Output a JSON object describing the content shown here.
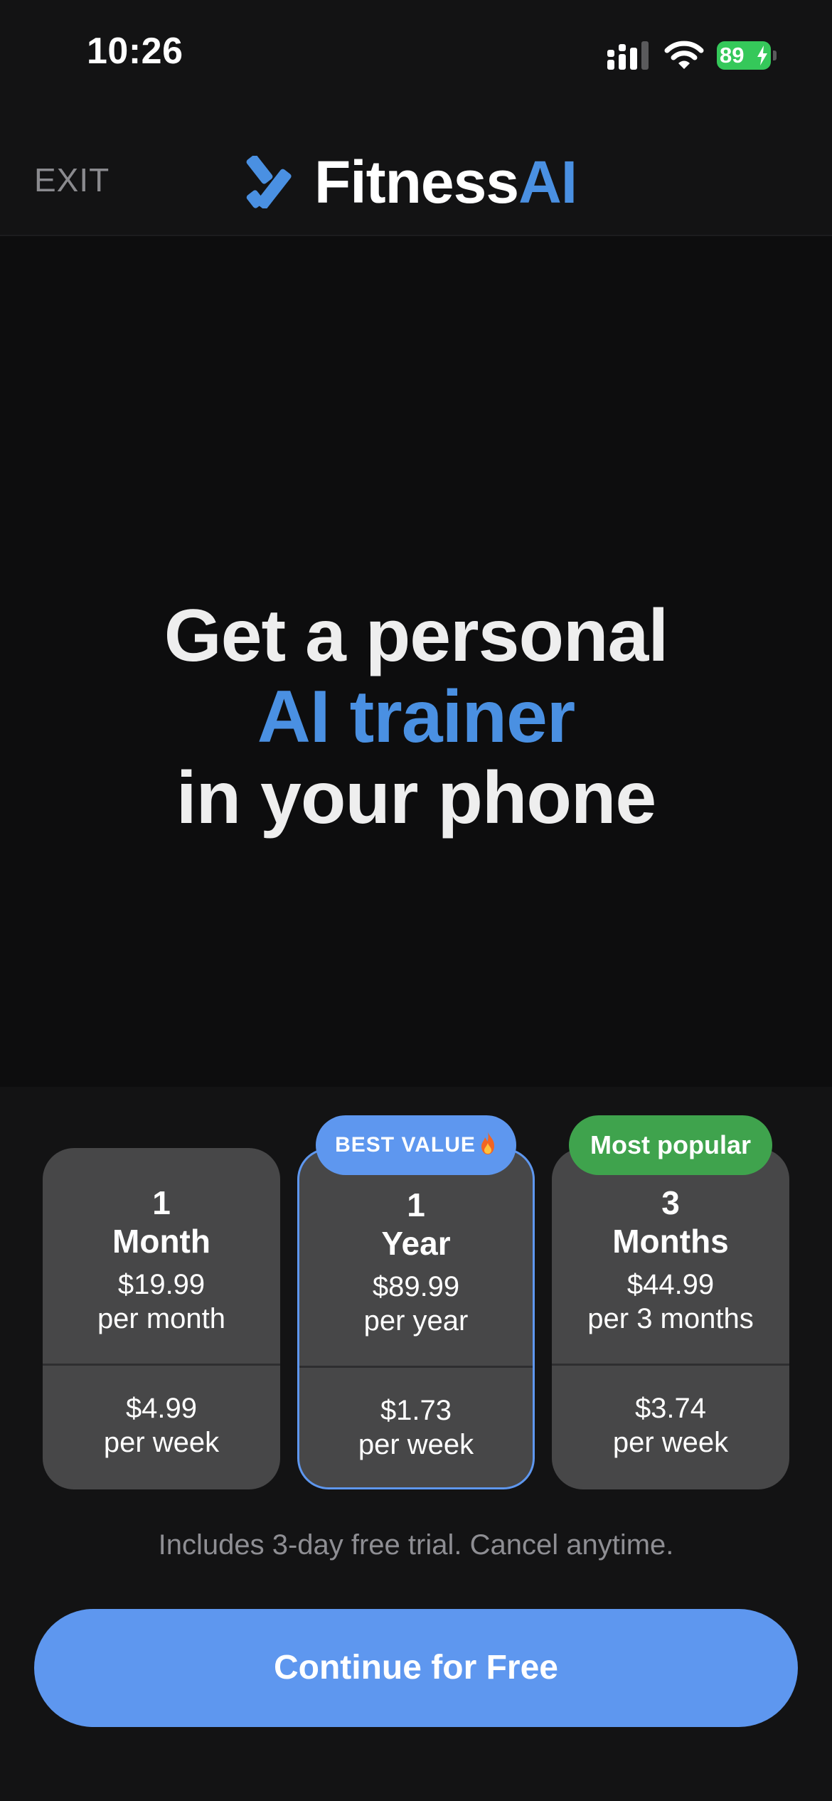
{
  "status_bar": {
    "time": "10:26",
    "battery_level": "89",
    "battery_color": "#35c85a"
  },
  "nav": {
    "exit_label": "EXIT",
    "logo_text_primary": "Fitness",
    "logo_text_accent": "AI",
    "accent_color": "#4a90e2"
  },
  "hero": {
    "line1": "Get a personal",
    "line2": "AI trainer",
    "line3": "in your phone"
  },
  "plans": [
    {
      "duration_number": "1",
      "duration_unit": "Month",
      "price": "$19.99",
      "period": "per month",
      "weekly_price": "$4.99",
      "weekly_label": "per week",
      "selected": false
    },
    {
      "duration_number": "1",
      "duration_unit": "Year",
      "price": "$89.99",
      "period": "per year",
      "weekly_price": "$1.73",
      "weekly_label": "per week",
      "selected": true,
      "badge": "BEST VALUE",
      "badge_icon": "flame-icon",
      "badge_color": "#5e97ef"
    },
    {
      "duration_number": "3",
      "duration_unit": "Months",
      "price": "$44.99",
      "period": "per 3 months",
      "weekly_price": "$3.74",
      "weekly_label": "per week",
      "selected": false,
      "badge": "Most popular",
      "badge_color": "#3fa34d"
    }
  ],
  "trial_note": "Includes 3-day free trial. Cancel anytime.",
  "cta": {
    "label": "Continue for Free",
    "color": "#5e97ef"
  }
}
